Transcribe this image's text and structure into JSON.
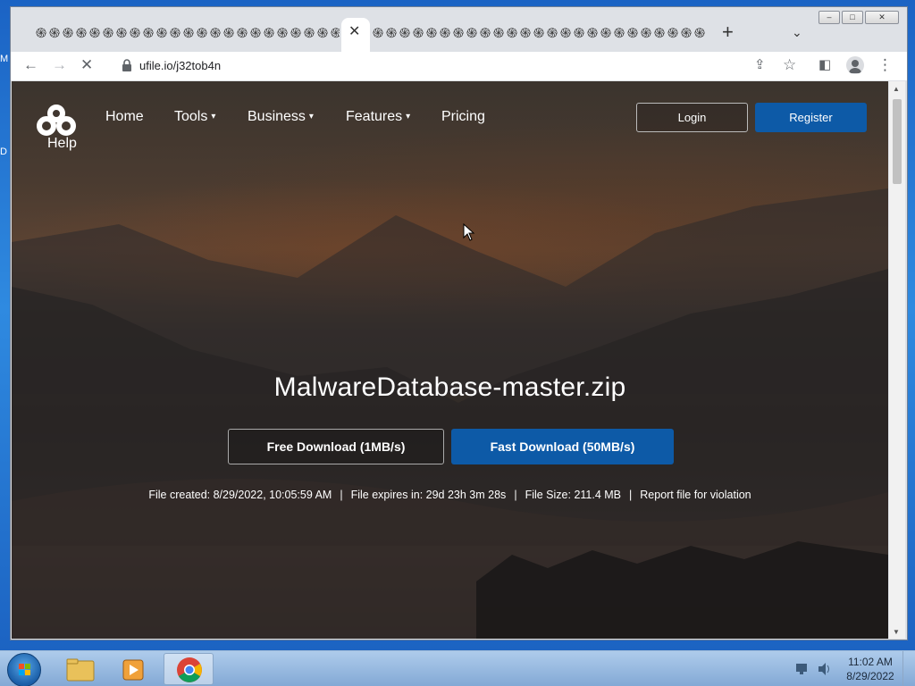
{
  "desktop": {
    "edge_glyph_top": "M",
    "edge_glyph_mid": "D"
  },
  "browser": {
    "tab_glyph": "֍",
    "url": "ufile.io/j32tob4n",
    "window_buttons": {
      "minimize": "–",
      "maximize": "□",
      "close": "✕"
    }
  },
  "site": {
    "logo_caption": "Help",
    "nav": {
      "home": "Home",
      "tools": "Tools",
      "business": "Business",
      "features": "Features",
      "pricing": "Pricing"
    },
    "chevron": "⌄",
    "login": "Login",
    "register": "Register"
  },
  "file": {
    "name": "MalwareDatabase-master.zip",
    "free_download": "Free Download (1MB/s)",
    "fast_download": "Fast Download (50MB/s)",
    "created": "File created: 8/29/2022, 10:05:59 AM",
    "expires": "File expires in: 29d 23h 3m 28s",
    "size": "File Size: 211.4 MB",
    "report": "Report file for violation",
    "separator": "|"
  },
  "taskbar": {
    "time": "11:02 AM",
    "date": "8/29/2022"
  },
  "colors": {
    "brand_blue": "#0d5aa7",
    "chrome_frame": "#dee1e6"
  }
}
